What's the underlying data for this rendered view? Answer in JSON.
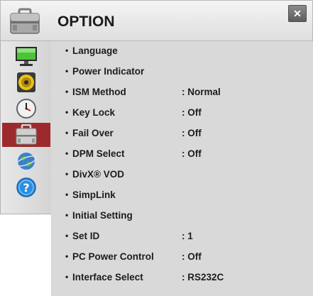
{
  "header": {
    "title": "OPTION",
    "close_glyph": "✕",
    "icon": "toolbox-icon"
  },
  "sidebar": {
    "items": [
      {
        "icon": "monitor-icon",
        "active": false
      },
      {
        "icon": "speaker-icon",
        "active": false
      },
      {
        "icon": "clock-icon",
        "active": false
      },
      {
        "icon": "toolbox-icon",
        "active": true
      },
      {
        "icon": "globe-icon",
        "active": false
      },
      {
        "icon": "help-icon",
        "active": false
      }
    ]
  },
  "menu": {
    "bullet": "•",
    "items": [
      {
        "label": "Language",
        "value": ""
      },
      {
        "label": "Power Indicator",
        "value": ""
      },
      {
        "label": "ISM Method",
        "value": ": Normal"
      },
      {
        "label": "Key Lock",
        "value": ": Off"
      },
      {
        "label": "Fail Over",
        "value": ": Off"
      },
      {
        "label": "DPM Select",
        "value": ": Off"
      },
      {
        "label": "DivX® VOD",
        "value": ""
      },
      {
        "label": "SimpLink",
        "value": ""
      },
      {
        "label": "Initial Setting",
        "value": ""
      },
      {
        "label": "Set ID",
        "value": ": 1"
      },
      {
        "label": "PC Power Control",
        "value": ": Off"
      },
      {
        "label": "Interface Select",
        "value": ": RS232C"
      }
    ]
  },
  "colors": {
    "active_sidebar": "#9c2a2d",
    "content_bg": "#d9d9d9"
  }
}
